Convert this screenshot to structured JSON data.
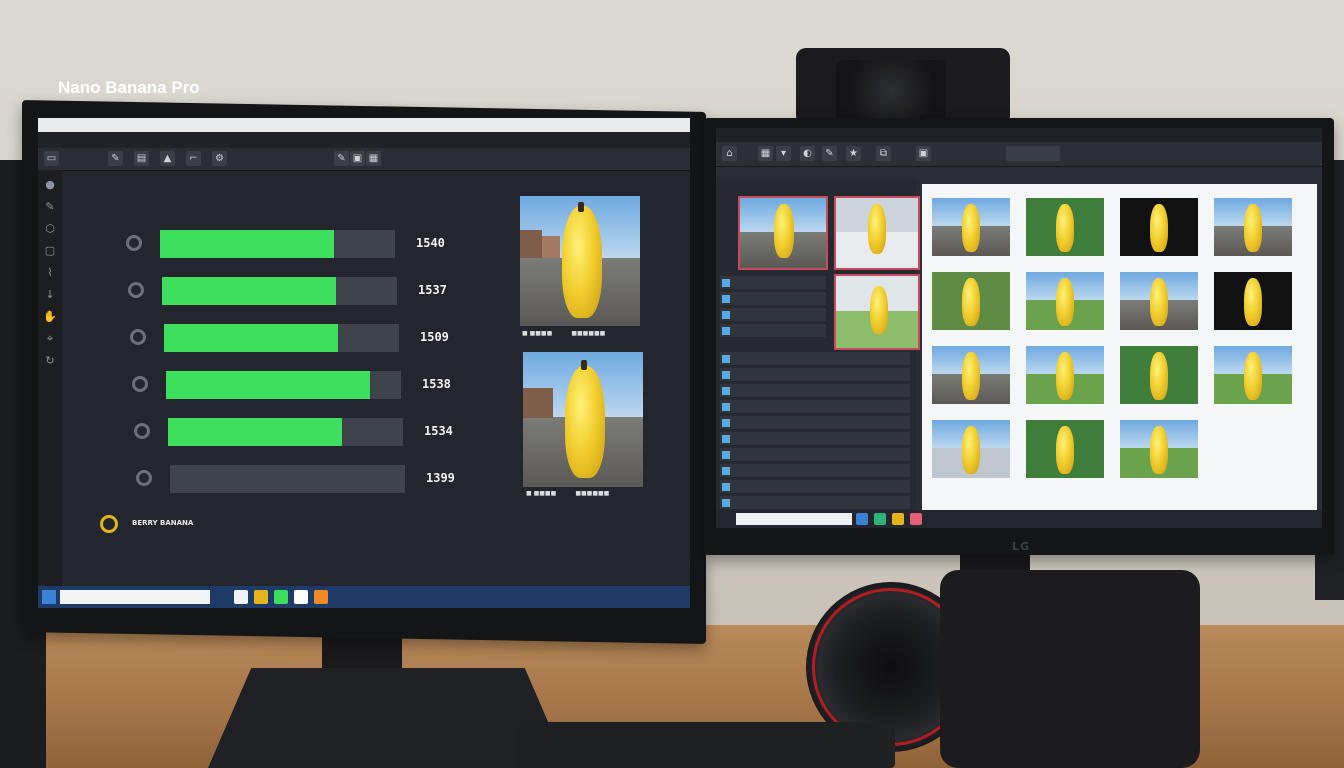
{
  "left_monitor": {
    "app_title": "Nano Banana Pro",
    "bars": [
      {
        "value": "1540",
        "fill": 0.74
      },
      {
        "value": "1537",
        "fill": 0.74
      },
      {
        "value": "1509",
        "fill": 0.74
      },
      {
        "value": "1538",
        "fill": 0.87
      },
      {
        "value": "1534",
        "fill": 0.74
      },
      {
        "value": "1399",
        "fill": 0.0
      }
    ],
    "legend_label": "BERRY BANANA",
    "colors": {
      "bar": "#3cde5b",
      "track": "#3f444c",
      "legend_ring": "#e3b21d"
    }
  },
  "right_monitor": {
    "gallery_rows": 4,
    "accent": "#c84a5c"
  }
}
